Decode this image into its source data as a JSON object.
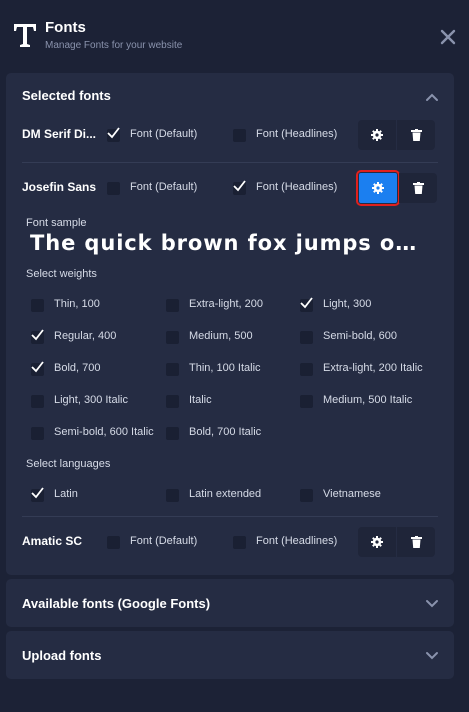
{
  "header": {
    "title": "Fonts",
    "subtitle": "Manage Fonts for your website",
    "logo_icon": "letter-t-icon",
    "close_icon": "close-icon"
  },
  "selected_fonts": {
    "title": "Selected fonts",
    "expanded": true,
    "fonts": [
      {
        "name": "DM Serif Di...",
        "default_label": "Font (Default)",
        "default_checked": true,
        "headlines_label": "Font (Headlines)",
        "headlines_checked": false
      },
      {
        "name": "Josefin Sans",
        "default_label": "Font (Default)",
        "default_checked": false,
        "headlines_label": "Font (Headlines)",
        "headlines_checked": true,
        "settings_active": true
      },
      {
        "name": "Amatic SC",
        "default_label": "Font (Default)",
        "default_checked": false,
        "headlines_label": "Font (Headlines)",
        "headlines_checked": false
      }
    ],
    "font_sample_label": "Font sample",
    "font_sample_text": "The quick brown fox jumps over the...",
    "weights_label": "Select weights",
    "weights": [
      {
        "label": "Thin, 100",
        "checked": false
      },
      {
        "label": "Extra-light, 200",
        "checked": false
      },
      {
        "label": "Light, 300",
        "checked": true
      },
      {
        "label": "Regular, 400",
        "checked": true
      },
      {
        "label": "Medium, 500",
        "checked": false
      },
      {
        "label": "Semi-bold, 600",
        "checked": false
      },
      {
        "label": "Bold, 700",
        "checked": true
      },
      {
        "label": "Thin, 100 Italic",
        "checked": false
      },
      {
        "label": "Extra-light, 200 Italic",
        "checked": false
      },
      {
        "label": "Light, 300 Italic",
        "checked": false
      },
      {
        "label": "Italic",
        "checked": false
      },
      {
        "label": "Medium, 500 Italic",
        "checked": false
      },
      {
        "label": "Semi-bold, 600 Italic",
        "checked": false
      },
      {
        "label": "Bold, 700 Italic",
        "checked": false
      }
    ],
    "languages_label": "Select languages",
    "languages": [
      {
        "label": "Latin",
        "checked": true
      },
      {
        "label": "Latin extended",
        "checked": false
      },
      {
        "label": "Vietnamese",
        "checked": false
      }
    ]
  },
  "available_fonts": {
    "title": "Available fonts (Google Fonts)",
    "expanded": false
  },
  "upload_fonts": {
    "title": "Upload fonts",
    "expanded": false
  },
  "colors": {
    "background": "#1c2236",
    "panel": "#252c43",
    "accent": "#1b7ff0",
    "highlight": "#e0201d"
  }
}
